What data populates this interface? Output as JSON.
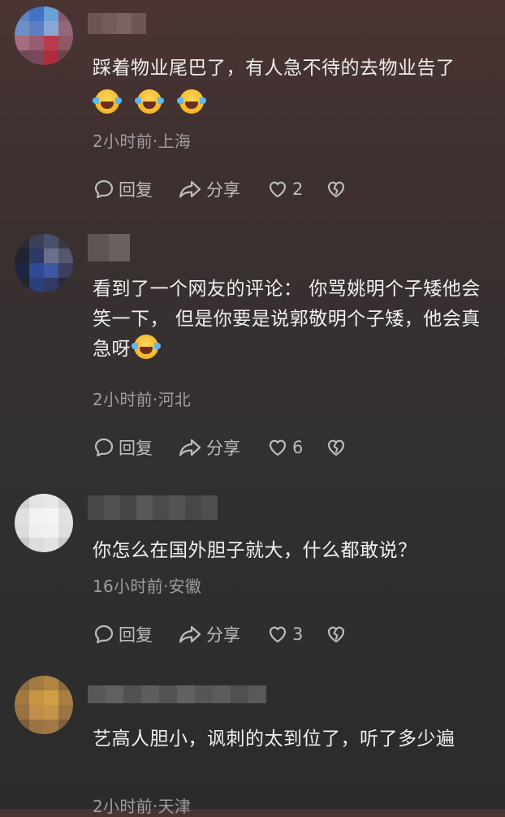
{
  "comments": [
    {
      "text": "踩着物业尾巴了，有人急不待的去物业告了",
      "emoji_count": 3,
      "meta": "2小时前·上海",
      "reply_label": "回复",
      "share_label": "分享",
      "likes": "2"
    },
    {
      "text": "看到了一个网友的评论： 你骂姚明个子矮他会笑一下， 但是你要是说郭敬明个子矮，他会真急呀",
      "meta": "2小时前·河北",
      "reply_label": "回复",
      "share_label": "分享",
      "likes": "6"
    },
    {
      "text": "你怎么在国外胆子就大，什么都敢说？",
      "meta": "16小时前·安徽",
      "reply_label": "回复",
      "share_label": "分享",
      "likes": "3"
    },
    {
      "text": "艺高人胆小，讽刺的太到位了，听了多少遍",
      "meta": "2小时前·天津"
    }
  ],
  "icons": {
    "reply": "reply-icon",
    "share": "share-icon",
    "like": "heart-icon",
    "dislike": "broken-heart-icon",
    "emoji": "laughing-crying-emoji"
  },
  "colors": {
    "text": "#efefef",
    "meta": "#9e9e9e",
    "action": "#bdbdbd"
  }
}
